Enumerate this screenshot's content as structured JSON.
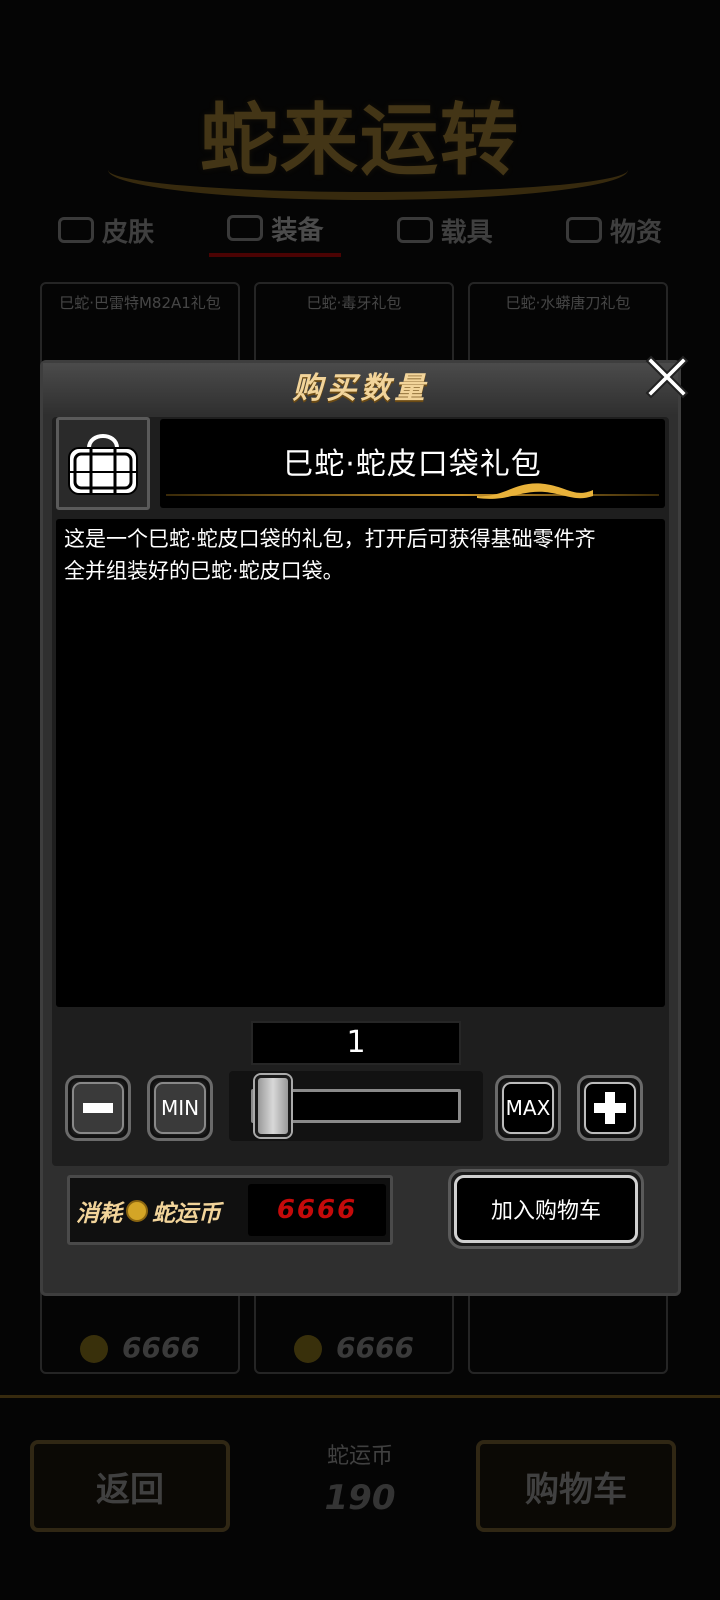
{
  "background": {
    "title": "蛇来运转",
    "tabs": [
      {
        "label": "皮肤",
        "icon": "box-icon"
      },
      {
        "label": "装备",
        "icon": "shield-icon"
      },
      {
        "label": "载具",
        "icon": "car-icon"
      },
      {
        "label": "物资",
        "icon": "crate-icon"
      }
    ],
    "cards": [
      {
        "name": "巳蛇·巴雷特M82A1礼包",
        "price": "6666"
      },
      {
        "name": "巳蛇·毒牙礼包",
        "price": "6666"
      },
      {
        "name": "巳蛇·水蟒唐刀礼包",
        "price": ""
      }
    ],
    "back_label": "返回",
    "currency_label": "蛇运币",
    "currency_value": "190",
    "cart_label": "购物车"
  },
  "modal": {
    "title": "购买数量",
    "item_name": "巳蛇·蛇皮口袋礼包",
    "item_icon": "bag-icon",
    "description": "这是一个巳蛇·蛇皮口袋的礼包，打开后可获得基础零件齐\n全并组装好的巳蛇·蛇皮口袋。",
    "quantity": "1",
    "min_label": "MIN",
    "max_label": "MAX",
    "slider_fraction": 0,
    "cost_label_prefix": "消耗",
    "cost_currency": "蛇运币",
    "cost_value": "6666",
    "add_to_cart_label": "加入购物车"
  },
  "colors": {
    "accent_gold": "#f2d49a",
    "cost_red": "#c40a0a",
    "panel": "#2f2f2f"
  }
}
